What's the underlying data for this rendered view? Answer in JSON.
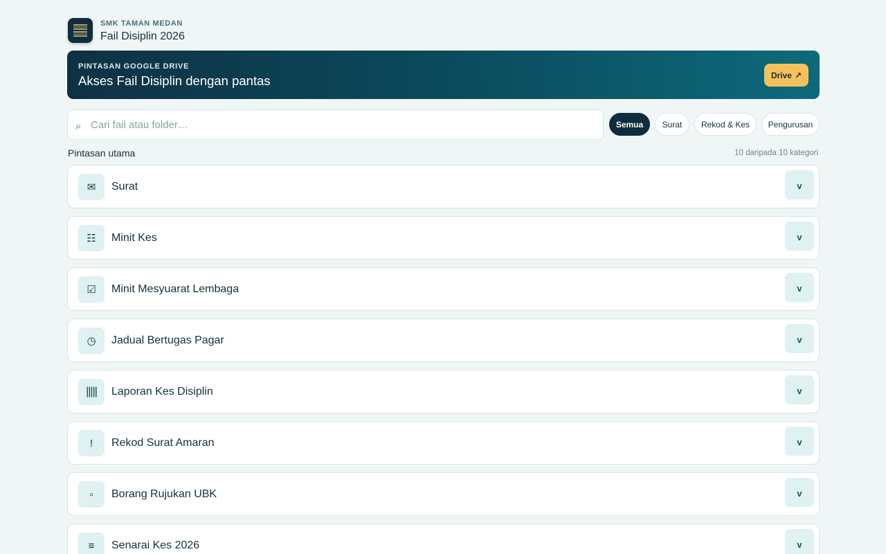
{
  "header": {
    "school": "SMK TAMAN MEDAN",
    "title": "Fail Disiplin 2026"
  },
  "banner": {
    "kicker": "PINTASAN GOOGLE DRIVE",
    "title": "Akses Fail Disiplin dengan pantas",
    "button_label": "Drive",
    "button_icon": "↗"
  },
  "search": {
    "placeholder": "Cari fail atau folder…",
    "value": "",
    "icon": "⌕"
  },
  "filters": [
    "Semua",
    "Surat",
    "Rekod & Kes",
    "Pengurusan"
  ],
  "active_filter": "Semua",
  "section": {
    "label": "Pintasan utama",
    "count": "10 daripada 10 kategori"
  },
  "categories": [
    {
      "label": "Surat",
      "icon": "✉",
      "icon_name": "envelope-icon"
    },
    {
      "label": "Minit Kes",
      "icon": "☷",
      "icon_name": "list-icon"
    },
    {
      "label": "Minit Mesyuarat Lembaga",
      "icon": "☑",
      "icon_name": "checkbox-icon"
    },
    {
      "label": "Jadual Bertugas Pagar",
      "icon": "◷",
      "icon_name": "clock-icon"
    },
    {
      "label": "Laporan Kes Disiplin",
      "icon": "|||||",
      "icon_name": "report-icon"
    },
    {
      "label": "Rekod Surat Amaran",
      "icon": "!",
      "icon_name": "warning-icon"
    },
    {
      "label": "Borang Rujukan UBK",
      "icon": "▫",
      "icon_name": "form-icon"
    },
    {
      "label": "Senarai Kes 2026",
      "icon": "≡",
      "icon_name": "menu-lines-icon"
    }
  ],
  "toggle_icon": "v",
  "colors": {
    "background": "#f0f6f6",
    "primary_dark": "#0f2d3c",
    "accent": "#f4c25d",
    "icon_tint": "#dff1f1"
  }
}
